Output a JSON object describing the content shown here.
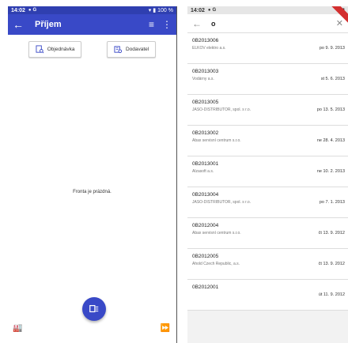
{
  "left_phone": {
    "status": {
      "time": "14:02",
      "right": "100 %"
    },
    "appbar": {
      "title": "Příjem"
    },
    "buttons": {
      "order": "Objednávka",
      "supplier": "Dodavatel"
    },
    "empty_message": "Fronta je prázdná."
  },
  "right_phone": {
    "status": {
      "time": "14:02"
    },
    "search": {
      "query": "o"
    },
    "results": [
      {
        "code": "0B2013006",
        "name": "ELKOV elektro a.s.",
        "date": "po 9. 9. 2013"
      },
      {
        "code": "0B2013003",
        "name": "Vodárny a.s.",
        "date": "st 5. 6. 2013"
      },
      {
        "code": "0B2013005",
        "name": "JASO-DISTRIBUTOR, spol. s r.o.",
        "date": "po 13. 5. 2013"
      },
      {
        "code": "0B2013002",
        "name": "Abax servisní centrum s.r.o.",
        "date": "ne 28. 4. 2013"
      },
      {
        "code": "0B2013001",
        "name": "Alzasoft a.s.",
        "date": "ne 10. 2. 2013"
      },
      {
        "code": "0B2013004",
        "name": "JASO-DISTRIBUTOR, spol. s r.o.",
        "date": "po 7. 1. 2013"
      },
      {
        "code": "0B2012004",
        "name": "Abax servisní centrum s.r.o.",
        "date": "čt 13. 9. 2012"
      },
      {
        "code": "0B2012005",
        "name": "Ahold Czech Republic, a.s.",
        "date": "čt 13. 9. 2012"
      },
      {
        "code": "0B2012001",
        "name": "",
        "date": "út 11. 9. 2012"
      }
    ]
  },
  "colors": {
    "primary": "#3949c7",
    "status_dark": "#2f3fb0"
  }
}
